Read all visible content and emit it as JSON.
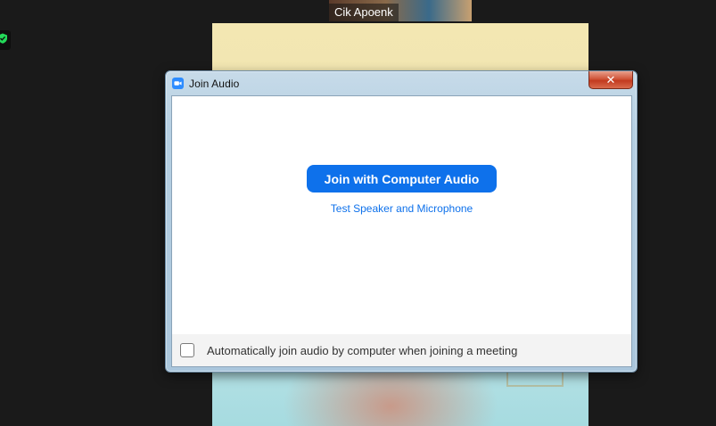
{
  "background": {
    "participant_name": "Cik Apoenk"
  },
  "dialog": {
    "title": "Join Audio",
    "close_symbol": "✕",
    "join_button_label": "Join with Computer Audio",
    "test_link_label": "Test Speaker and Microphone",
    "auto_join_label": "Automatically join audio by computer when joining a meeting",
    "auto_join_checked": false
  },
  "icons": {
    "app": "zoom-camera-icon",
    "security": "shield-check-icon",
    "close": "close-icon"
  },
  "colors": {
    "accent": "#0e71eb",
    "app_icon": "#2d8cff",
    "shield": "#23d959",
    "background": "#1a1a1a"
  }
}
